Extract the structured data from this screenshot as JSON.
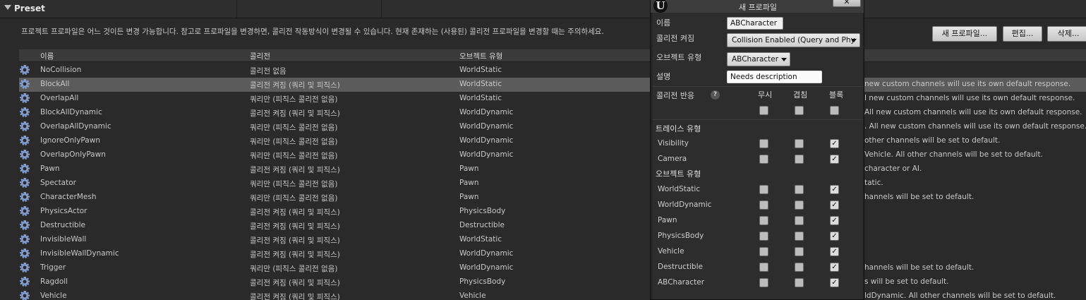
{
  "section": {
    "title": "Preset"
  },
  "description": "프로젝트 프로파일은 어느 것이든 변경 가능합니다. 참고로 프로파일을 변경하면, 콜리전 작동방식이 변경될 수 있습니다. 현재 존재하는 (사용된) 콜리전 프로파일을 변경할 때는 주의하세요.",
  "buttons": {
    "new": "새 프로파일...",
    "edit": "편집...",
    "delete": "삭제..."
  },
  "table": {
    "headers": {
      "name": "이름",
      "collision": "콜리전",
      "object_type": "오브젝트 유형"
    },
    "rows": [
      {
        "name": "NoCollision",
        "collision": "콜리전 없음",
        "object_type": "WorldStatic",
        "desc": ""
      },
      {
        "name": "BlockAll",
        "collision": "콜리전 켜짐 (쿼리 및 피직스)",
        "object_type": "WorldStatic",
        "desc": "new custom channels will use its own default response."
      },
      {
        "name": "OverlapAll",
        "collision": "쿼리만 (피직스 콜리전 없음)",
        "object_type": "WorldStatic",
        "desc": "l new custom channels will use its own default response."
      },
      {
        "name": "BlockAllDynamic",
        "collision": "콜리전 켜짐 (쿼리 및 피직스)",
        "object_type": "WorldDynamic",
        "desc": "All new custom channels will use its own default response."
      },
      {
        "name": "OverlapAllDynamic",
        "collision": "쿼리만 (피직스 콜리전 없음)",
        "object_type": "WorldDynamic",
        "desc": ". All new custom channels will use its own default response."
      },
      {
        "name": "IgnoreOnlyPawn",
        "collision": "쿼리만 (피직스 콜리전 없음)",
        "object_type": "WorldDynamic",
        "desc": "other channels will be set to default."
      },
      {
        "name": "OverlapOnlyPawn",
        "collision": "쿼리만 (피직스 콜리전 없음)",
        "object_type": "WorldDynamic",
        "desc": "Vehicle. All other channels will be set to default."
      },
      {
        "name": "Pawn",
        "collision": "콜리전 켜짐 (쿼리 및 피직스)",
        "object_type": "Pawn",
        "desc": "character or AI."
      },
      {
        "name": "Spectator",
        "collision": "쿼리만 (피직스 콜리전 없음)",
        "object_type": "Pawn",
        "desc": "tatic."
      },
      {
        "name": "CharacterMesh",
        "collision": "쿼리만 (피직스 콜리전 없음)",
        "object_type": "Pawn",
        "desc": "hannels will be set to default."
      },
      {
        "name": "PhysicsActor",
        "collision": "콜리전 켜짐 (쿼리 및 피직스)",
        "object_type": "PhysicsBody",
        "desc": ""
      },
      {
        "name": "Destructible",
        "collision": "콜리전 켜짐 (쿼리 및 피직스)",
        "object_type": "Destructible",
        "desc": ""
      },
      {
        "name": "InvisibleWall",
        "collision": "콜리전 켜짐 (쿼리 및 피직스)",
        "object_type": "WorldStatic",
        "desc": ""
      },
      {
        "name": "InvisibleWallDynamic",
        "collision": "콜리전 켜짐 (쿼리 및 피직스)",
        "object_type": "WorldDynamic",
        "desc": ""
      },
      {
        "name": "Trigger",
        "collision": "쿼리만 (피직스 콜리전 없음)",
        "object_type": "WorldDynamic",
        "desc": "hannels will be set to default."
      },
      {
        "name": "Ragdoll",
        "collision": "콜리전 켜짐 (쿼리 및 피직스)",
        "object_type": "PhysicsBody",
        "desc": "s will be set to default."
      },
      {
        "name": "Vehicle",
        "collision": "콜리전 켜짐 (쿼리 및 피직스)",
        "object_type": "Vehicle",
        "desc": "ldDynamic. All other channels will be set to default."
      }
    ]
  },
  "dialog": {
    "title": "새 프로파일",
    "close_label": "✕",
    "name_label": "이름",
    "name_value": "ABCharacter",
    "collision_label": "콜리전 켜짐",
    "collision_value": "Collision Enabled (Query and Phy",
    "object_type_label": "오브젝트 유형",
    "object_type_value": "ABCharacter",
    "desc_label": "설명",
    "desc_value": "Needs description",
    "response_label": "콜리전 반응",
    "hint_icon": "?",
    "columns": {
      "ignore": "무시",
      "overlap": "겹침",
      "block": "블록"
    },
    "trace_header": "트레이스 유형",
    "object_header": "오브젝트 유형",
    "trace_channels": [
      {
        "name": "Visibility"
      },
      {
        "name": "Camera"
      }
    ],
    "object_channels": [
      {
        "name": "WorldStatic"
      },
      {
        "name": "WorldDynamic"
      },
      {
        "name": "Pawn"
      },
      {
        "name": "PhysicsBody"
      },
      {
        "name": "Vehicle"
      },
      {
        "name": "Destructible"
      },
      {
        "name": "ABCharacter"
      }
    ],
    "check_mark": "✓"
  },
  "icons": {
    "logo": "U",
    "row_icon": "gear-icon",
    "expand": "triangle-down-icon"
  }
}
